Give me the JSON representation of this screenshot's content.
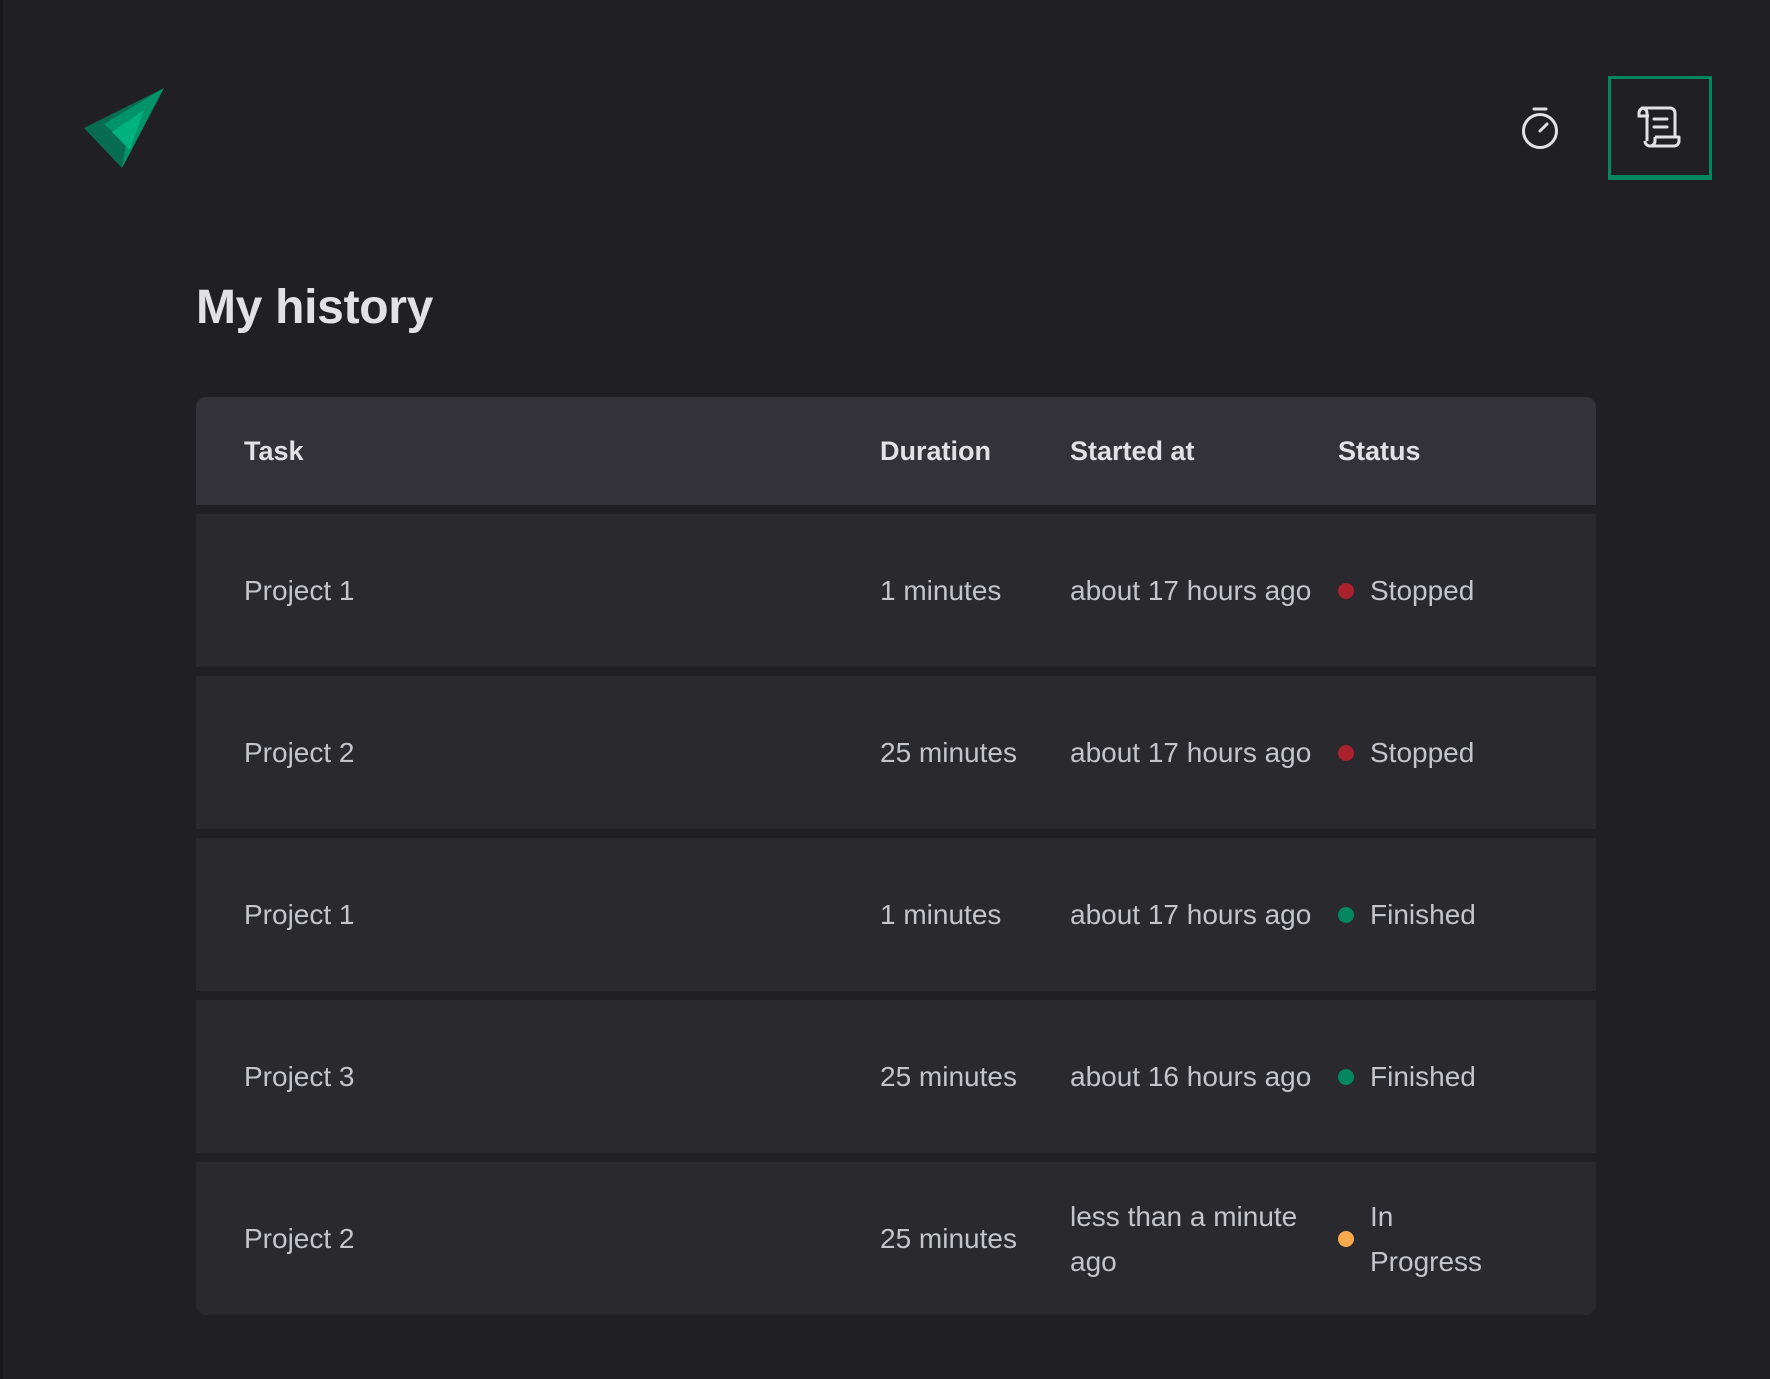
{
  "header": {
    "nav": [
      {
        "icon": "timer-icon",
        "active": false
      },
      {
        "icon": "scroll-icon",
        "active": true
      }
    ]
  },
  "page": {
    "title": "My history"
  },
  "table": {
    "columns": [
      "Task",
      "Duration",
      "Started at",
      "Status"
    ],
    "rows": [
      {
        "task": "Project 1",
        "duration": "1 minutes",
        "started_at": "about 17 hours ago",
        "status": "Stopped",
        "status_color": "#ab222e"
      },
      {
        "task": "Project 2",
        "duration": "25 minutes",
        "started_at": "about 17 hours ago",
        "status": "Stopped",
        "status_color": "#ab222e"
      },
      {
        "task": "Project 1",
        "duration": "1 minutes",
        "started_at": "about 17 hours ago",
        "status": "Finished",
        "status_color": "#00875f"
      },
      {
        "task": "Project 3",
        "duration": "25 minutes",
        "started_at": "about 16 hours ago",
        "status": "Finished",
        "status_color": "#00875f"
      },
      {
        "task": "Project 2",
        "duration": "25 minutes",
        "started_at": "less than a minute ago",
        "status": "In Progress",
        "status_color": "#fba94c"
      }
    ]
  },
  "colors": {
    "background": "#202024",
    "accent": "#00875f",
    "header_row": "#323238",
    "body_row": "#29292e"
  }
}
